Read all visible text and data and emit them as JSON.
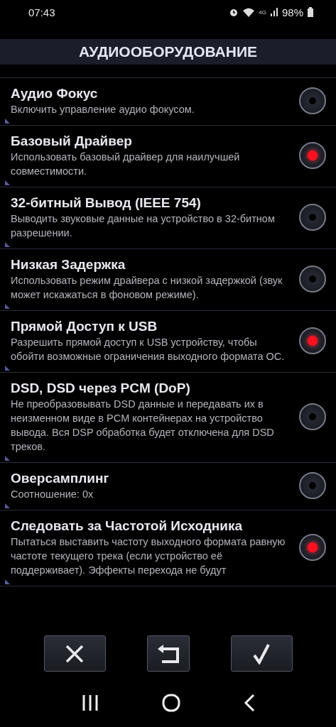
{
  "status_bar": {
    "time": "07:43",
    "network": "4G",
    "battery": "98%"
  },
  "header": {
    "title": "АУДИООБОРУДОВАНИЕ"
  },
  "settings": [
    {
      "title": "Аудио Фокус",
      "description": "Включить управление аудио фокусом.",
      "on": false
    },
    {
      "title": "Базовый Драйвер",
      "description": "Использовать базовый драйвер для наилучшей совместимости.",
      "on": true
    },
    {
      "title": "32-битный Вывод (IEEE 754)",
      "description": "Выводить звуковые данные на устройство в 32-битном разрешении.",
      "on": false
    },
    {
      "title": "Низкая Задержка",
      "description": "Использовать режим драйвера с низкой задержкой (звук может искажаться в фоновом режиме).",
      "on": false
    },
    {
      "title": "Прямой Доступ к USB",
      "description": "Разрешить прямой доступ к USB устройству, чтобы обойти возможные ограничения выходного формата ОС.",
      "on": true
    },
    {
      "title": "DSD, DSD через PCM (DoP)",
      "description": "Не преобразовывать DSD данные и передавать их в неизменном виде в PCM контейнерах на устройство вывода. Вся DSP обработка будет отключена для DSD треков.",
      "on": false
    },
    {
      "title": "Оверсамплинг",
      "description": "Соотношение: 0x",
      "on": false
    },
    {
      "title": "Следовать за Частотой Исходника",
      "description": "Пытаться выставить частоту выходного формата равную частоте текущего трека (если устройство её поддерживает). Эффекты перехода не будут",
      "on": true
    }
  ],
  "action_buttons": [
    {
      "kind": "cancel"
    },
    {
      "kind": "reset"
    },
    {
      "kind": "confirm"
    }
  ]
}
